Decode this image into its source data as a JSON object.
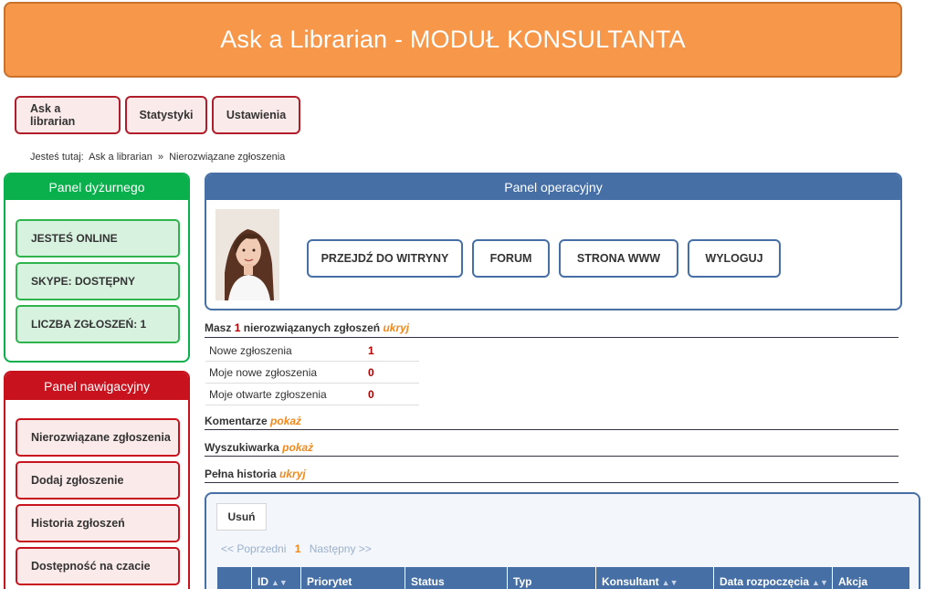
{
  "header": {
    "title": "Ask a Librarian - MODUŁ KONSULTANTA"
  },
  "topnav": {
    "items": [
      "Ask a librarian",
      "Statystyki",
      "Ustawienia"
    ]
  },
  "breadcrumb": {
    "prefix": "Jesteś tutaj:",
    "items": [
      "Ask a librarian",
      "»",
      "Nierozwiązane zgłoszenia"
    ]
  },
  "duty_panel": {
    "title": "Panel dyżurnego",
    "items": [
      "JESTEŚ ONLINE",
      "SKYPE: DOSTĘPNY",
      "LICZBA ZGŁOSZEŃ: 1"
    ]
  },
  "nav_panel": {
    "title": "Panel nawigacyjny",
    "items": [
      "Nierozwiązane zgłoszenia",
      "Dodaj zgłoszenie",
      "Historia zgłoszeń",
      "Dostępność na czacie"
    ]
  },
  "op_panel": {
    "title": "Panel operacyjny",
    "buttons": [
      "PRZEJDŹ DO WITRYNY",
      "FORUM",
      "STRONA WWW",
      "WYLOGUJ"
    ]
  },
  "summary": {
    "prefix": "Masz",
    "count": "1",
    "suffix": "nierozwiązanych zgłoszeń",
    "toggle": "ukryj",
    "rows": [
      {
        "label": "Nowe zgłoszenia",
        "value": "1"
      },
      {
        "label": "Moje nowe zgłoszenia",
        "value": "0"
      },
      {
        "label": "Moje otwarte zgłoszenia",
        "value": "0"
      }
    ]
  },
  "sections": [
    {
      "label": "Komentarze",
      "toggle": "pokaż"
    },
    {
      "label": "Wyszukiwarka",
      "toggle": "pokaż"
    },
    {
      "label": "Pełna historia",
      "toggle": "ukryj"
    }
  ],
  "table": {
    "delete_label": "Usuń",
    "pager": {
      "prev": "<< Poprzedni",
      "current": "1",
      "next": "Następny >>"
    },
    "columns": [
      "",
      "ID",
      "Priorytet",
      "Status",
      "Typ",
      "Konsultant",
      "Data rozpoczęcia",
      "Akcja"
    ]
  },
  "colors": {
    "header": "#f7974a",
    "duty": "#0ab04b",
    "nav": "#c8131f",
    "operational": "#466fa6",
    "toggle": "#f08a1c"
  }
}
